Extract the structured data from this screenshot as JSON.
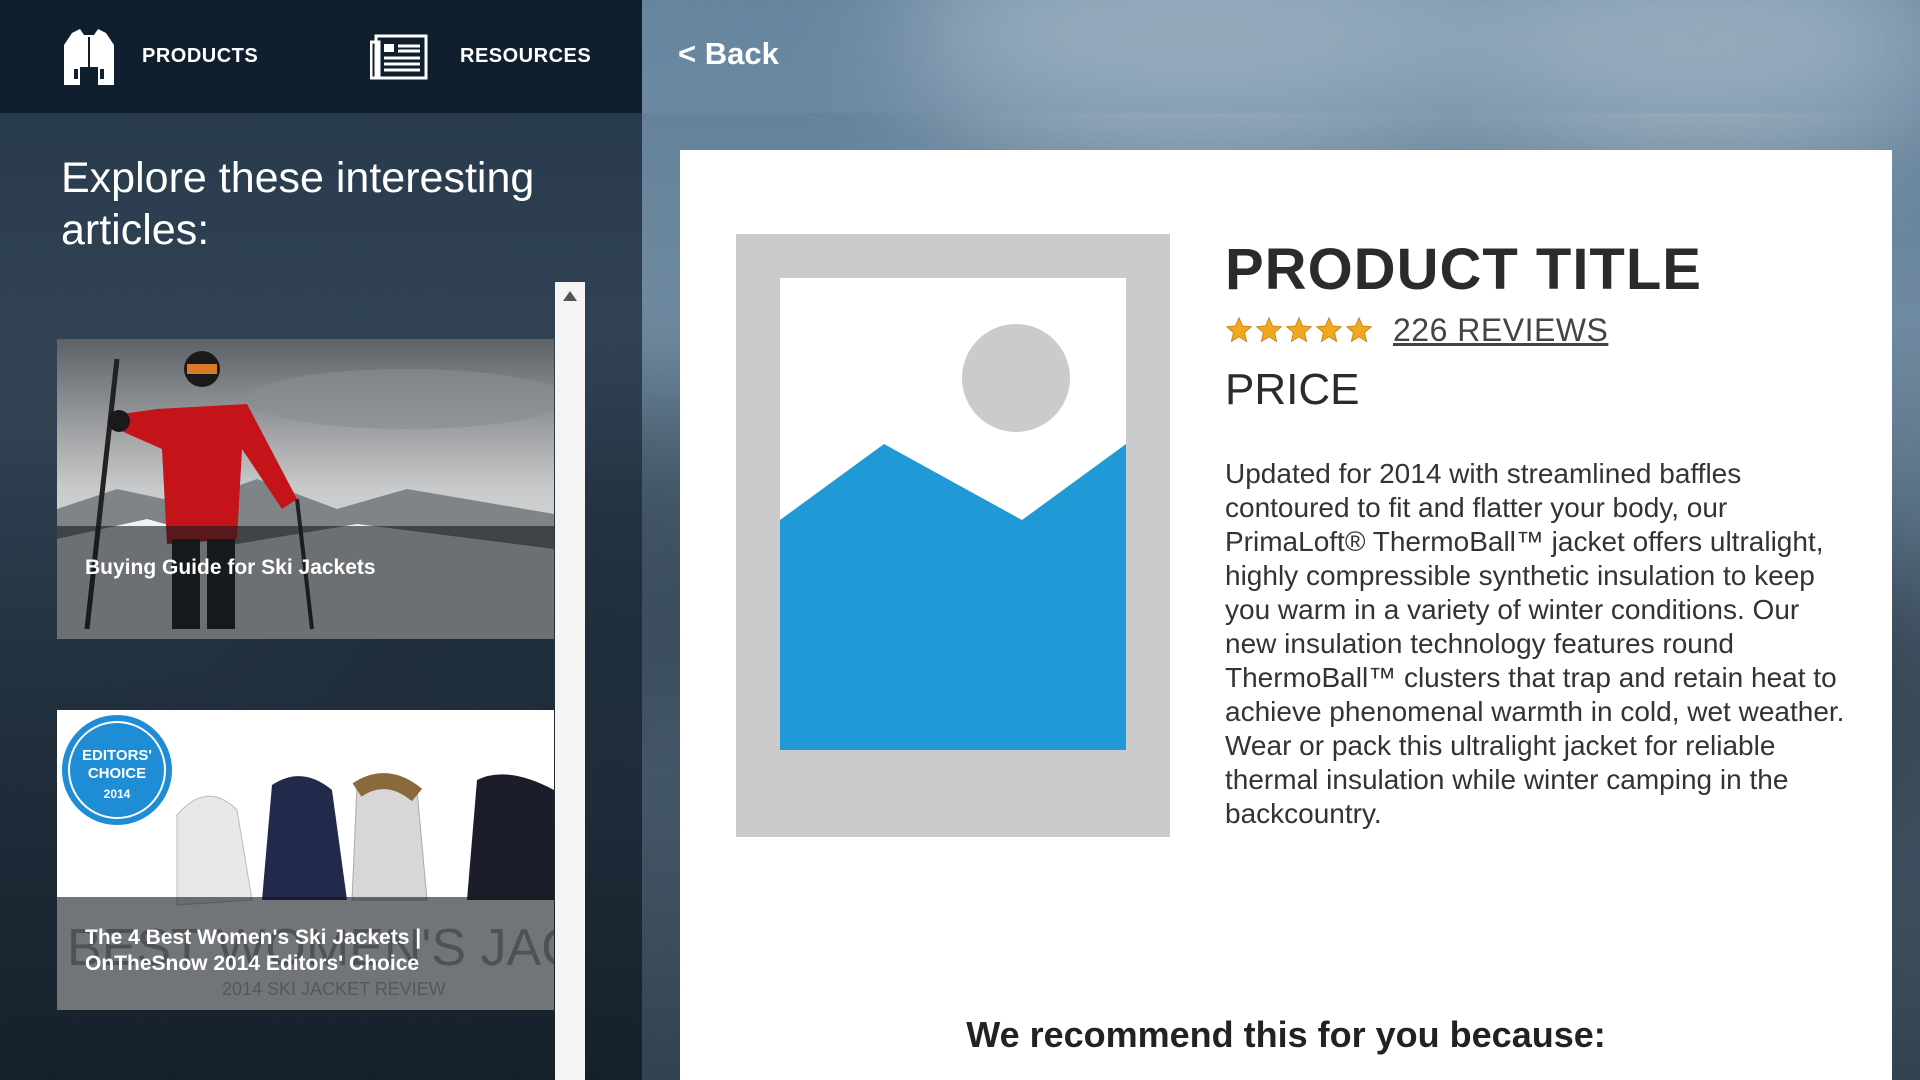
{
  "nav": {
    "products_label": "PRODUCTS",
    "resources_label": "RESOURCES"
  },
  "sidebar": {
    "title": "Explore these interesting articles:",
    "articles": [
      {
        "caption": "Buying Guide for Ski Jackets"
      },
      {
        "caption_line1": "The 4 Best Women's Ski Jackets |",
        "caption_line2": "OnTheSnow 2014 Editors' Choice",
        "badge": "EDITORS' CHOICE 2014"
      }
    ]
  },
  "back_label": "< Back",
  "product": {
    "title": "PRODUCT TITLE",
    "rating_stars": 5,
    "reviews_label": "226 REVIEWS",
    "price": "PRICE",
    "description": "Updated for 2014 with streamlined baffles contoured to fit and flatter your body, our PrimaLoft® ThermoBall™ jacket offers ultralight, highly compressible synthetic insulation to keep you warm in a variety of winter conditions. Our new insulation technology features round ThermoBall™ clusters that trap and retain heat to achieve phenomenal warmth in cold, wet weather. Wear or pack this ultralight jacket for reliable thermal insulation while winter camping in the backcountry.",
    "recommend_heading": "We recommend this for you because:"
  },
  "colors": {
    "nav_bg": "#0f1f2e",
    "star": "#f2a81d",
    "placeholder_blue": "#1f9ad6",
    "placeholder_gray": "#cbcbcb"
  }
}
